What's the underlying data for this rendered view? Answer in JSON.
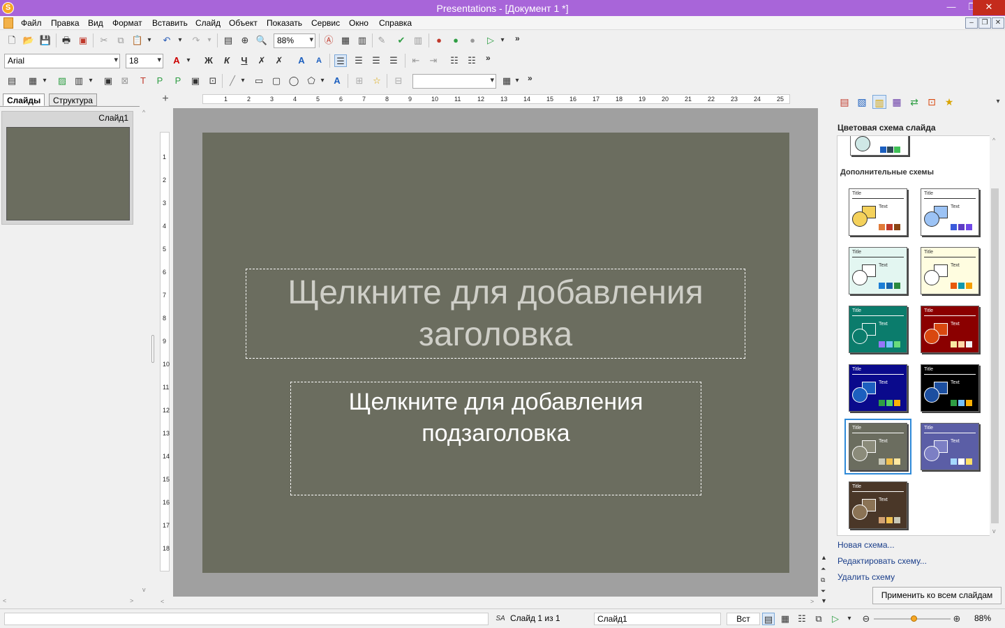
{
  "window": {
    "title": "Presentations - [Документ 1 *]",
    "app_icon_letter": "S",
    "minimize": "—",
    "restore": "❐",
    "close": "✕"
  },
  "menu": {
    "items": [
      "Файл",
      "Правка",
      "Вид",
      "Формат",
      "Вставить",
      "Слайд",
      "Объект",
      "Показать",
      "Сервис",
      "Окно",
      "Справка"
    ],
    "mdi_controls": [
      "–",
      "❐",
      "✕"
    ]
  },
  "toolbar1": {
    "zoom_value": "88%"
  },
  "toolbar2": {
    "font_name": "Arial",
    "font_size": "18",
    "bold": "Ж",
    "italic": "К",
    "underline": "Ч"
  },
  "toolbar3": {
    "style_combo_value": ""
  },
  "left_panel": {
    "tab_slides": "Слайды",
    "tab_outline": "Структура",
    "slide_label": "Слайд1"
  },
  "ruler": {
    "h_numbers": [
      "1",
      "2",
      "3",
      "4",
      "5",
      "6",
      "7",
      "8",
      "9",
      "10",
      "11",
      "12",
      "13",
      "14",
      "15",
      "16",
      "17",
      "18",
      "19",
      "20",
      "21",
      "22",
      "23",
      "24",
      "25"
    ],
    "v_numbers": [
      "1",
      "2",
      "3",
      "4",
      "5",
      "6",
      "7",
      "8",
      "9",
      "10",
      "11",
      "12",
      "13",
      "14",
      "15",
      "16",
      "17",
      "18"
    ]
  },
  "slide": {
    "background_color": "#6b6d5f",
    "title_line1": "Щелкните для добавления",
    "title_line2": "заголовка",
    "subtitle_line1": "Щелкните для добавления",
    "subtitle_line2": "подзаголовка"
  },
  "task_pane": {
    "section_title": "Цветовая схема слайда",
    "extra_schemes_title": "Дополнительные схемы",
    "scheme_title_text": "Title",
    "scheme_body_text": "Text",
    "schemes": [
      {
        "bg": "#ffffff",
        "fg": "#333333",
        "shape": "#f4d15b",
        "swatches": [
          "#e07b39",
          "#c0392b",
          "#8b4513"
        ]
      },
      {
        "bg": "#ffffff",
        "fg": "#333333",
        "shape": "#9cc3f5",
        "swatches": [
          "#3b5bdb",
          "#5f3dc4",
          "#7048e8"
        ]
      },
      {
        "bg": "#e3f6f1",
        "fg": "#333333",
        "shape": "#ffffff",
        "swatches": [
          "#1c7ed6",
          "#1864ab",
          "#2b8a3e"
        ]
      },
      {
        "bg": "#fffde0",
        "fg": "#333333",
        "shape": "#ffffff",
        "swatches": [
          "#e8590c",
          "#1098ad",
          "#f59f00"
        ]
      },
      {
        "bg": "#0b7c6c",
        "fg": "#ffffff",
        "shape": "#0b7c6c",
        "swatches": [
          "#9775fa",
          "#74c0fc",
          "#69db7c"
        ]
      },
      {
        "bg": "#8b0000",
        "fg": "#ffffff",
        "shape": "#d9480f",
        "swatches": [
          "#f8e9a1",
          "#ffd8a8",
          "#f1f3f5"
        ]
      },
      {
        "bg": "#0a0a8c",
        "fg": "#ffffff",
        "shape": "#1c5fbf",
        "swatches": [
          "#2f9e44",
          "#51cf66",
          "#fab005"
        ]
      },
      {
        "bg": "#000000",
        "fg": "#ffffff",
        "shape": "#1c4fa0",
        "swatches": [
          "#2f9e44",
          "#74c0fc",
          "#fab005"
        ]
      },
      {
        "bg": "#6b6d5f",
        "fg": "#ffffff",
        "shape": "#8b8b7a",
        "swatches": [
          "#c9c9b8",
          "#f2c14e",
          "#ffe8a1"
        ]
      },
      {
        "bg": "#5b5ea6",
        "fg": "#ffffff",
        "shape": "#7c7fc4",
        "swatches": [
          "#a5d8ff",
          "#ffffff",
          "#ffe066"
        ]
      },
      {
        "bg": "#4a3728",
        "fg": "#ffffff",
        "shape": "#8b7355",
        "swatches": [
          "#d4a373",
          "#f2c14e",
          "#c9c9b8"
        ]
      }
    ],
    "selected_scheme": 8,
    "link_new": "Новая схема...",
    "link_edit": "Редактировать схему...",
    "link_delete": "Удалить схему",
    "apply_all": "Применить ко всем слайдам"
  },
  "statusbar": {
    "slide_counter": "Слайд 1 из 1",
    "slide_name": "Слайд1",
    "insert_mode": "Вст",
    "zoom": "88%",
    "zoom_fraction": 0.52
  }
}
